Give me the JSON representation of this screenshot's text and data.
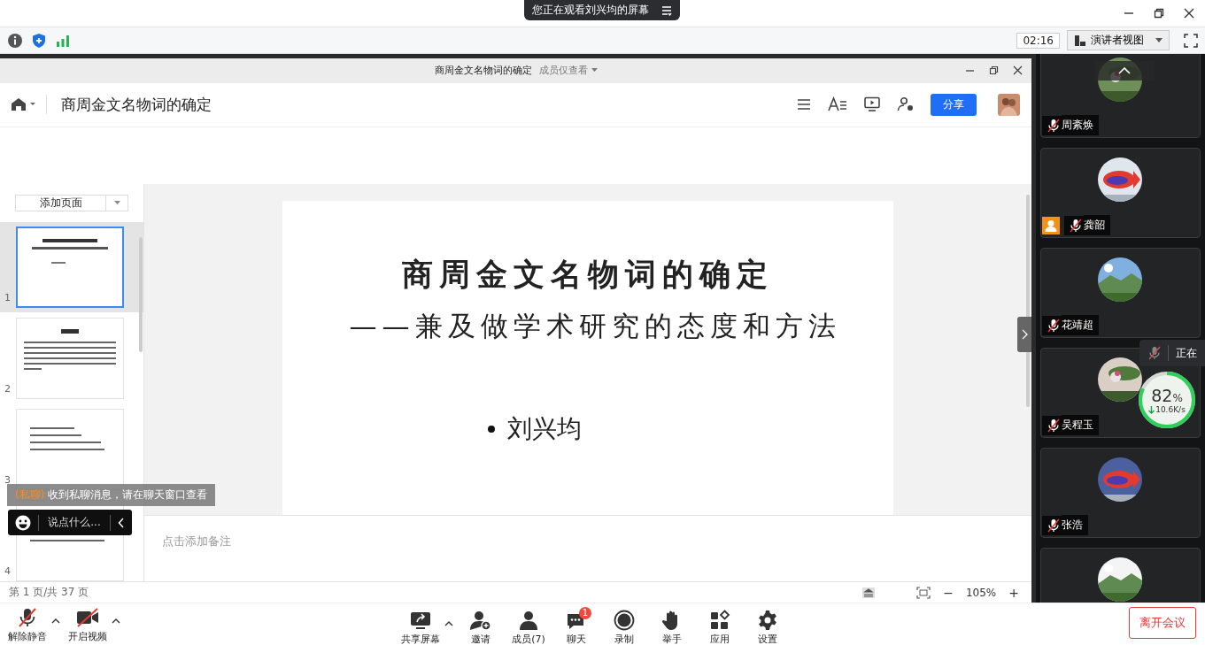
{
  "banner": {
    "text": "您正在观看刘兴均的屏幕"
  },
  "toolbar": {
    "timer": "02:16",
    "view_button": "演讲者视图"
  },
  "document_window": {
    "title": "商周金文名物词的确定",
    "permission": "成员仅查看",
    "doc_title": "商周金文名物词的确定",
    "share_button": "分享",
    "add_page_button": "添加页面",
    "thumbnails": [
      {
        "number": "1",
        "selected": true,
        "kind": "title"
      },
      {
        "number": "2",
        "selected": false,
        "kind": "paragraph"
      },
      {
        "number": "3",
        "selected": false,
        "kind": "list"
      },
      {
        "number": "4",
        "selected": false,
        "kind": "list"
      }
    ],
    "slide": {
      "title": "商周金文名物词的确定",
      "subtitle": "——兼及做学术研究的态度和方法",
      "bullets": [
        "刘兴均"
      ]
    },
    "notes_placeholder": "点击添加备注",
    "page_indicator": "第 1 页/共 37 页",
    "zoom_out": "−",
    "zoom": "105%",
    "zoom_in": "+"
  },
  "notification": {
    "tag": "(私聊)",
    "text": "收到私聊消息，请在聊天窗口查看"
  },
  "chat_input": {
    "placeholder": "说点什么..."
  },
  "participants": [
    {
      "name": "周紊焕",
      "muted": true,
      "host": false,
      "avatar": {
        "kind": "picture"
      }
    },
    {
      "name": "龚韶",
      "muted": true,
      "host": true,
      "avatar": {
        "kind": "picture"
      }
    },
    {
      "name": "花靖超",
      "muted": true,
      "host": false,
      "avatar": {
        "kind": "picture"
      }
    },
    {
      "name": "吴程玉",
      "muted": true,
      "host": false,
      "avatar": {
        "kind": "picture"
      }
    },
    {
      "name": "张浩",
      "muted": true,
      "host": false,
      "avatar": {
        "kind": "picture"
      }
    },
    {
      "avatar": {
        "kind": "picture"
      }
    }
  ],
  "speaking_tooltip": {
    "text": "正在"
  },
  "network": {
    "percent": "82",
    "unit": "%",
    "speed": "10.6K/s"
  },
  "left_controls": [
    {
      "label": "解除静音",
      "kind": "mic"
    },
    {
      "label": "开启视频",
      "kind": "video"
    }
  ],
  "center_controls": [
    {
      "label": "共享屏幕",
      "kind": "share"
    },
    {
      "label": "邀请",
      "kind": "invite"
    },
    {
      "label": "成员(7)",
      "kind": "members"
    },
    {
      "label": "聊天",
      "kind": "chat",
      "badge": "1"
    },
    {
      "label": "录制",
      "kind": "record"
    },
    {
      "label": "举手",
      "kind": "hand"
    },
    {
      "label": "应用",
      "kind": "apps"
    },
    {
      "label": "设置",
      "kind": "settings"
    }
  ],
  "leave_button": "离开会议"
}
